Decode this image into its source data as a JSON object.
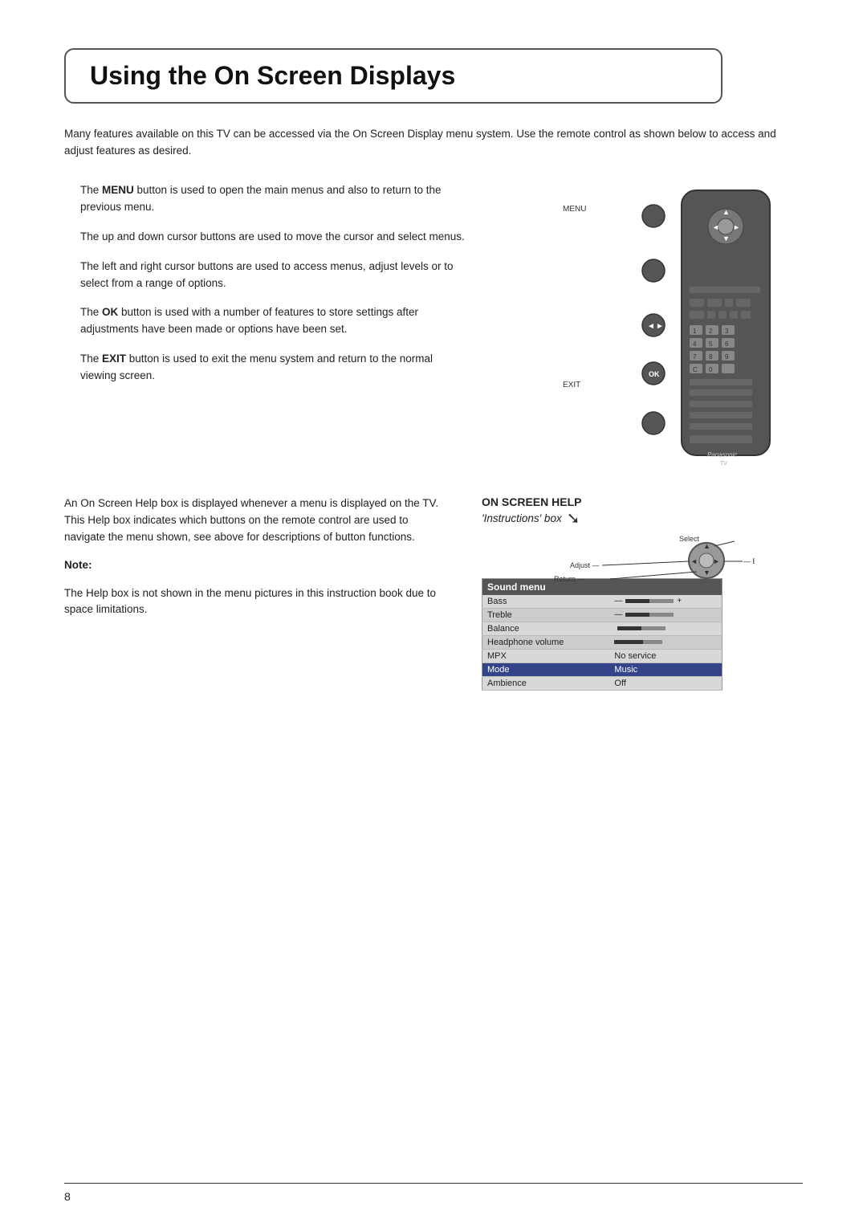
{
  "page": {
    "title": "Using the On Screen Displays",
    "intro": "Many features available on this TV can be accessed via the On Screen Display menu system. Use the remote control as shown below to access and adjust features as desired.",
    "descriptions": [
      {
        "id": "desc-menu",
        "text_bold": "MENU",
        "text": " button is used to open the main menus and also to return to the previous menu.",
        "prefix": "The "
      },
      {
        "id": "desc-cursor-updown",
        "text": "The up and down cursor buttons are used to move the cursor and select menus."
      },
      {
        "id": "desc-cursor-leftright",
        "text": "The left and right cursor buttons are used to access menus, adjust levels or to select from a range of options."
      },
      {
        "id": "desc-ok",
        "text_bold": "OK",
        "text": " button is used with a number of features to store settings after adjustments have been made or options have been set.",
        "prefix": "The "
      },
      {
        "id": "desc-exit",
        "text_bold": "EXIT",
        "text": " button is used to exit the menu system and return to the normal viewing screen.",
        "prefix": "The "
      }
    ],
    "remote_labels": {
      "menu": "MENU",
      "exit": "EXIT"
    },
    "help_section": {
      "intro_text": "An On Screen Help box is displayed whenever a menu is displayed on the TV. This Help box indicates which buttons on the remote control are used to navigate the menu shown, see above for descriptions of button functions.",
      "note_label": "Note:",
      "note_text": "The Help box is not shown in the menu pictures in this instruction book due to space limitations.",
      "on_screen_help_title": "ON SCREEN HELP",
      "instructions_box_label": "'Instructions' box",
      "dpad_labels": {
        "select": "Select",
        "adjust": "Adjust",
        "return": "Return",
        "exit": "Exit"
      },
      "sound_menu": {
        "header": "Sound menu",
        "rows": [
          {
            "label": "Bass",
            "value": "bar",
            "bar_pct": 50,
            "highlighted": false
          },
          {
            "label": "Treble",
            "value": "bar",
            "bar_pct": 50,
            "highlighted": false
          },
          {
            "label": "Balance",
            "value": "bar",
            "bar_pct": 50,
            "highlighted": false
          },
          {
            "label": "Headphone volume",
            "value": "bar",
            "bar_pct": 60,
            "highlighted": false
          },
          {
            "label": "MPX",
            "value": "No service",
            "highlighted": false
          },
          {
            "label": "Mode",
            "value": "Music",
            "highlighted": true
          },
          {
            "label": "Ambience",
            "value": "Off",
            "highlighted": false
          }
        ]
      }
    },
    "footer": {
      "page_number": "8"
    }
  }
}
